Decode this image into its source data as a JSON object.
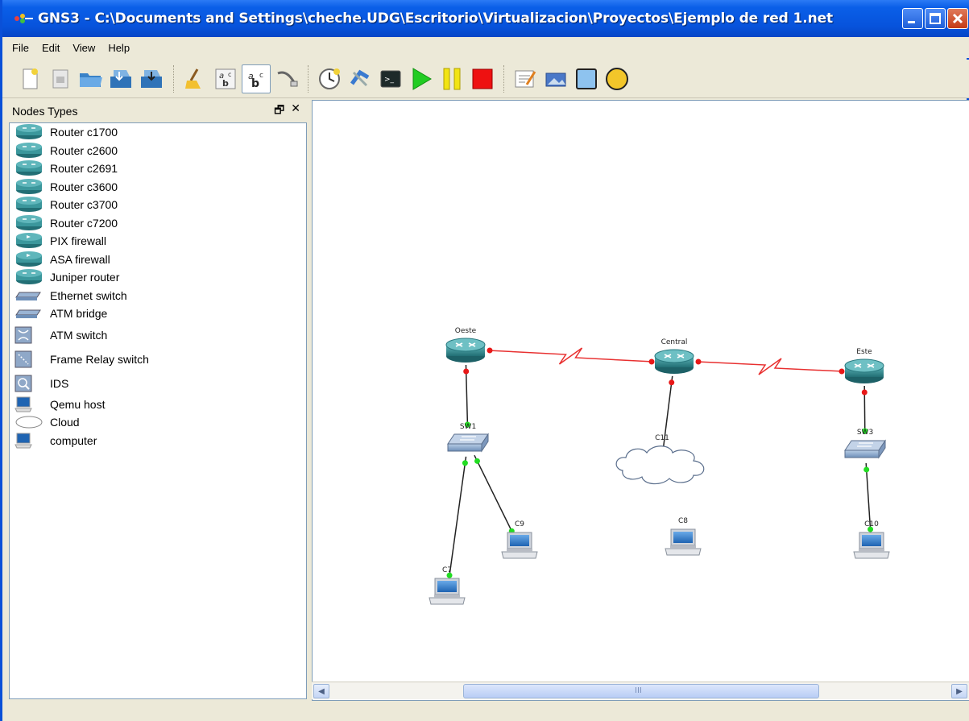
{
  "window": {
    "title": "GNS3 - C:\\Documents and Settings\\cheche.UDG\\Escritorio\\Virtualizacion\\Proyectos\\Ejemplo de red 1.net"
  },
  "menu": [
    "File",
    "Edit",
    "View",
    "Help"
  ],
  "toolbar": [
    {
      "name": "new-icon"
    },
    {
      "name": "open-project-icon"
    },
    {
      "name": "open-folder-icon"
    },
    {
      "name": "save-icon"
    },
    {
      "name": "save-as-icon"
    },
    {
      "name": "clear-icon"
    },
    {
      "name": "show-hostnames-icon"
    },
    {
      "name": "show-interface-labels-icon"
    },
    {
      "name": "add-link-icon"
    },
    {
      "name": "clock-icon"
    },
    {
      "name": "capture-icon"
    },
    {
      "name": "console-icon"
    },
    {
      "name": "start-icon"
    },
    {
      "name": "suspend-icon"
    },
    {
      "name": "stop-icon"
    },
    {
      "name": "add-note-icon"
    },
    {
      "name": "insert-picture-icon"
    },
    {
      "name": "draw-rectangle-icon"
    },
    {
      "name": "draw-ellipse-icon"
    }
  ],
  "dock": {
    "title": "Nodes Types",
    "items": [
      {
        "label": "Router c1700",
        "icon": "router-icon"
      },
      {
        "label": "Router c2600",
        "icon": "router-icon"
      },
      {
        "label": "Router c2691",
        "icon": "router-icon"
      },
      {
        "label": "Router c3600",
        "icon": "router-icon"
      },
      {
        "label": "Router c3700",
        "icon": "router-icon"
      },
      {
        "label": "Router c7200",
        "icon": "router-icon"
      },
      {
        "label": "PIX firewall",
        "icon": "firewall-icon"
      },
      {
        "label": "ASA firewall",
        "icon": "firewall-icon"
      },
      {
        "label": "Juniper router",
        "icon": "router-icon"
      },
      {
        "label": "Ethernet switch",
        "icon": "switch-icon"
      },
      {
        "label": "ATM bridge",
        "icon": "bridge-icon"
      },
      {
        "label": "ATM switch",
        "icon": "atm-switch-icon"
      },
      {
        "label": "Frame Relay switch",
        "icon": "frame-relay-icon"
      },
      {
        "label": "IDS",
        "icon": "ids-icon"
      },
      {
        "label": "Qemu host",
        "icon": "computer-icon"
      },
      {
        "label": "Cloud",
        "icon": "cloud-icon"
      },
      {
        "label": "computer",
        "icon": "computer-icon"
      }
    ]
  },
  "topology": {
    "nodes": [
      {
        "id": "Oeste",
        "label": "Oeste",
        "type": "router"
      },
      {
        "id": "Central",
        "label": "Central",
        "type": "router"
      },
      {
        "id": "Este",
        "label": "Este",
        "type": "router"
      },
      {
        "id": "SW1",
        "label": "SW1",
        "type": "switch"
      },
      {
        "id": "SW3",
        "label": "SW3",
        "type": "switch"
      },
      {
        "id": "C11",
        "label": "C11",
        "type": "cloud"
      },
      {
        "id": "C7",
        "label": "C7",
        "type": "computer"
      },
      {
        "id": "C9",
        "label": "C9",
        "type": "computer"
      },
      {
        "id": "C8",
        "label": "C8",
        "type": "computer"
      },
      {
        "id": "C10",
        "label": "C10",
        "type": "computer"
      }
    ],
    "links": [
      {
        "from": "Oeste",
        "to": "Central",
        "kind": "serial",
        "color": "#e83030"
      },
      {
        "from": "Central",
        "to": "Este",
        "kind": "serial",
        "color": "#e83030"
      },
      {
        "from": "Oeste",
        "to": "SW1",
        "kind": "ethernet",
        "color": "#222222"
      },
      {
        "from": "Central",
        "to": "C11",
        "kind": "ethernet",
        "color": "#222222"
      },
      {
        "from": "Este",
        "to": "SW3",
        "kind": "ethernet",
        "color": "#222222"
      },
      {
        "from": "SW1",
        "to": "C7",
        "kind": "ethernet",
        "color": "#222222"
      },
      {
        "from": "SW1",
        "to": "C9",
        "kind": "ethernet",
        "color": "#222222"
      },
      {
        "from": "SW3",
        "to": "C10",
        "kind": "ethernet",
        "color": "#222222"
      }
    ]
  },
  "scrollbar": {
    "grip": "III"
  },
  "colors": {
    "titlebar": "#0753dc",
    "chrome": "#ece9d8",
    "router": "#2f8f95",
    "link_up": "#22dd22",
    "link_down": "#e81818"
  }
}
